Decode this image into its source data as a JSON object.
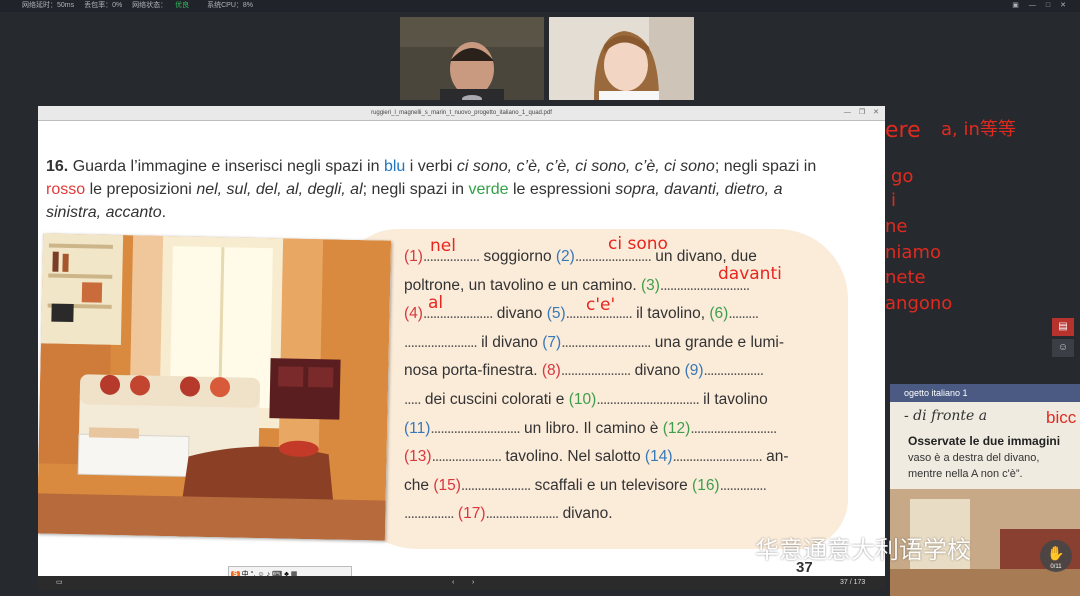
{
  "topbar": {
    "latency": "网络延时：50ms",
    "loss": "丢包率：0%",
    "net_label": "网络状态：",
    "net_value": "优良",
    "cpu": "系统CPU：8%"
  },
  "pdf": {
    "title": "ruggieri_l_magnelli_s_marin_t_nuovo_progetto_italiano_1_quad.pdf",
    "page_indicator": "37 / 173",
    "page_number": "37"
  },
  "exercise": {
    "number": "16.",
    "instr_a": "Guarda l’immagine e inserisci negli spazi in",
    "blu": "blu",
    "instr_b": "i verbi",
    "verbs": "ci sono, c’è, c’è, ci sono, c’è, ci sono",
    "instr_c": "; negli spazi in",
    "rosso": "rosso",
    "instr_d": "le preposizioni",
    "preps": "nel, sul, del, al, degli, al",
    "instr_e": "; negli spazi in",
    "verde": "verde",
    "instr_f": "le espressioni",
    "exprs": "sopra, davanti, dietro, a sinistra, accanto",
    "instr_g": "."
  },
  "lines": {
    "l1a": "soggiorno",
    "l1b": "un divano, due",
    "l2a": "poltrone, un tavolino e un camino.",
    "l3a": "divano",
    "l3b": "il tavolino,",
    "l4a": "il divano",
    "l4b": "una grande e lumi-",
    "l5a": "nosa porta-finestra.",
    "l5b": "divano",
    "l6a": "dei cuscini colorati e",
    "l6b": "il tavolino",
    "l7a": "un libro. Il camino è",
    "l8a": "tavolino. Nel salotto",
    "l8b": "an-",
    "l9a": "che",
    "l9b": "scaffali e un televisore",
    "l10a": "divano."
  },
  "blank_numbers": [
    "(1)",
    "(2)",
    "(3)",
    "(4)",
    "(5)",
    "(6)",
    "(7)",
    "(8)",
    "(9)",
    "(10)",
    "(11)",
    "(12)",
    "(13)",
    "(14)",
    "(15)",
    "(16)",
    "(17)"
  ],
  "annotations": {
    "a1": "nel",
    "a2": "ci sono",
    "a3": "davanti",
    "a4": "al",
    "a5": "c'e'"
  },
  "right_notes": {
    "n1": "ere",
    "n1b": "a, in等等",
    "n2": "go",
    "n3": "i",
    "n4": "ne",
    "n5": "niamo",
    "n6": "nete",
    "n7": "angono"
  },
  "mini_slide": {
    "header": "ogetto italiano 1",
    "hand": "- di fronte a",
    "ann": "bicc",
    "q": "Osservate le due immagini",
    "t1": "vaso è a destra del divano,",
    "t2": "mentre nella A non c'è”."
  },
  "ime_label": "中",
  "watermark": "华意通意大利语学校",
  "hand_count": "0/11",
  "colors": {
    "annotation": "#e8261e",
    "blue": "#1f77c2",
    "red": "#e23a3a",
    "green": "#33a047",
    "network_good": "#2fbf5b"
  }
}
